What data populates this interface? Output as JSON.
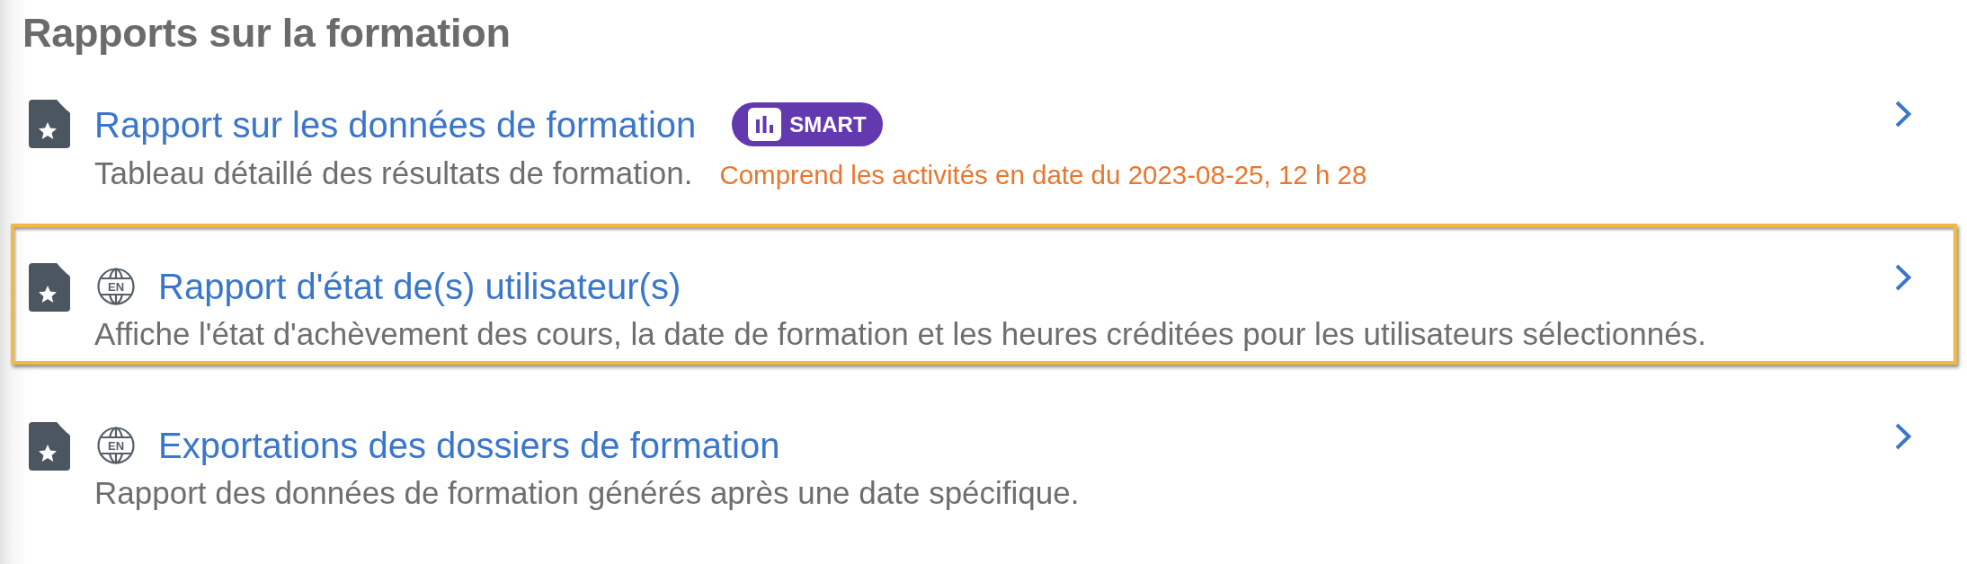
{
  "page_title": "Rapports sur la formation",
  "reports": [
    {
      "title": "Rapport sur les données de formation",
      "badge": "SMART",
      "description": "Tableau détaillé des résultats de formation.",
      "note": "Comprend les activités en date du 2023-08-25, 12 h 28",
      "highlighted": false
    },
    {
      "language": "EN",
      "title": "Rapport d'état de(s) utilisateur(s)",
      "description": "Affiche l'état d'achèvement des cours, la date de formation et les heures créditées pour les utilisateurs sélectionnés.",
      "highlighted": true
    },
    {
      "language": "EN",
      "title": "Exportations des dossiers de formation",
      "description": "Rapport des données de formation générés après une date spécifique.",
      "highlighted": false
    }
  ]
}
